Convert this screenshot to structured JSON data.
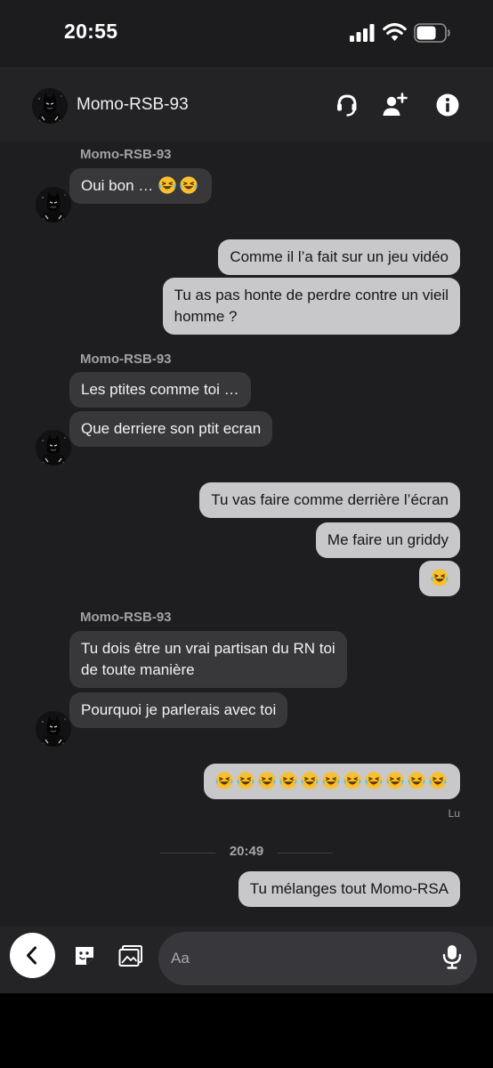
{
  "status_bar": {
    "time": "20:55",
    "battery_level": 0.7
  },
  "header": {
    "contact_name": "Momo-RSB-93"
  },
  "conversation": {
    "sender_name": "Momo-RSB-93",
    "groups": [
      {
        "direction": "in",
        "sender": "Momo-RSB-93",
        "messages": [
          {
            "text": "Oui bon … ",
            "emoji_count": 2
          }
        ]
      },
      {
        "direction": "out",
        "messages": [
          {
            "text": "Comme il l’a fait sur un jeu vidéo"
          },
          {
            "lines": [
              "Tu as pas honte de perdre contre un vieil",
              "homme ?"
            ]
          }
        ]
      },
      {
        "direction": "in",
        "sender": "Momo-RSB-93",
        "messages": [
          {
            "text": "Les ptites comme toi …"
          },
          {
            "text": "Que derriere son ptit ecran"
          }
        ]
      },
      {
        "direction": "out",
        "messages": [
          {
            "text": "Tu vas faire comme derrière l’écran"
          },
          {
            "text": "Me faire un griddy"
          },
          {
            "text": "",
            "emoji_count": 1
          }
        ]
      },
      {
        "direction": "in",
        "sender": "Momo-RSB-93",
        "messages": [
          {
            "lines": [
              "Tu dois être un vrai partisan du RN  toi",
              "de toute manière"
            ]
          },
          {
            "text": "Pourquoi je parlerais avec toi"
          }
        ]
      },
      {
        "direction": "out",
        "messages": [
          {
            "text": "",
            "emoji_count": 11
          }
        ]
      }
    ],
    "read_receipt": "Lu",
    "time_divider": "20:49",
    "last_message": "Tu mélanges tout Momo-RSA"
  },
  "composer": {
    "placeholder": "Aa"
  },
  "icons": {
    "emoji": "face-with-tears-of-joy",
    "header": [
      "headset-icon",
      "add-user-icon",
      "info-icon"
    ],
    "composer": [
      "back-chevron-icon",
      "sticker-icon",
      "image-icon",
      "microphone-icon"
    ]
  },
  "colors": {
    "bubble_in": "#38383b",
    "bubble_out": "#c8c8cb",
    "chat_background": "#1e1e20",
    "header_background": "#232326"
  }
}
